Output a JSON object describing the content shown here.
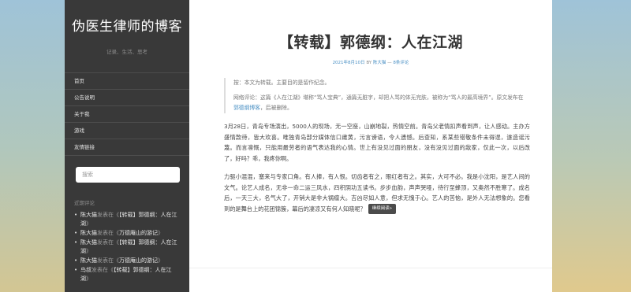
{
  "site": {
    "title": "伪医生律师的博客",
    "description": "记录、生活、思考"
  },
  "nav": [
    {
      "label": "首页"
    },
    {
      "label": "公告说明"
    },
    {
      "label": "关于我"
    },
    {
      "label": "游戏"
    },
    {
      "label": "友情链接"
    }
  ],
  "search": {
    "placeholder": "搜索"
  },
  "recent_comments": {
    "title": "近期评论",
    "items": [
      {
        "author": "陈大猫",
        "on": "发表在《",
        "post": "【转载】郭德纲：人在江湖",
        "end": "》"
      },
      {
        "author": "陈大猫",
        "on": "发表在《",
        "post": "万德庵山的游记",
        "end": "》"
      },
      {
        "author": "陈大猫",
        "on": "发表在《",
        "post": "【转载】郭德纲：人在江湖",
        "end": "》"
      },
      {
        "author": "陈大猫",
        "on": "发表在《",
        "post": "万德庵山的游记",
        "end": "》"
      },
      {
        "author": "鸟叔",
        "on": "发表在《",
        "post": "【转载】郭德纲：人在江湖",
        "end": "》"
      }
    ]
  },
  "post": {
    "title": "【转载】郭德纲：人在江湖",
    "date": "2021年8月10日",
    "by": "BY",
    "author": "陈大猫",
    "sep": "—",
    "comments": "8条评论",
    "quote_line1": "按：本文为转载。主要目的是留作纪念。",
    "quote_line2_a": "网络评论：这篇《人在江湖》堪称“骂人宝典”，通篇无脏字，却把人骂的体无完肤，被称为“骂人的最高境界”。原文发布在",
    "quote_link": "郭德纲博客",
    "quote_line2_b": "，后被删除。",
    "para1": "3月28日，青岛专场演出，5000人的现场，无一空座，山崩地裂，热情空前。青岛父老情扣声看到声，让人感动。主办方盛情款待，皆大欢喜。唯独青岛部分媒体信口雌黄，污言谤语，令人遗憾。后查知，系某些错敬条件未得逞，遂造谣污蔑。而言凛慨，只能用最劳者的语气表达我的心情。世上有没见过面的朋友，没有没见过面的敌家，仅此一次，以后改了，好吗？乖，我疼你啊。",
    "para2": "力驱小混混，塞来与专家口角。有人捧，有人恨。切齿者有之，眼红者有之。其实，大可不必。我是小沈阳，是艺人间的文气。论艺人成名，无非一命二运三风水，四积阴功五读书。步步血韵，声声哭哑，待行至蜂顶，又奥然不胜寒了。成名后，一天三大，名气大了，开销大是非大锅瘤大。吉凶尽如人意，但求无愧于心。艺人的苦恼，是外人无法想象的。您看到的是舞台上的花团锦簇，幕后的凄凉又有何人知晓呢？",
    "more": "继续阅读»"
  }
}
